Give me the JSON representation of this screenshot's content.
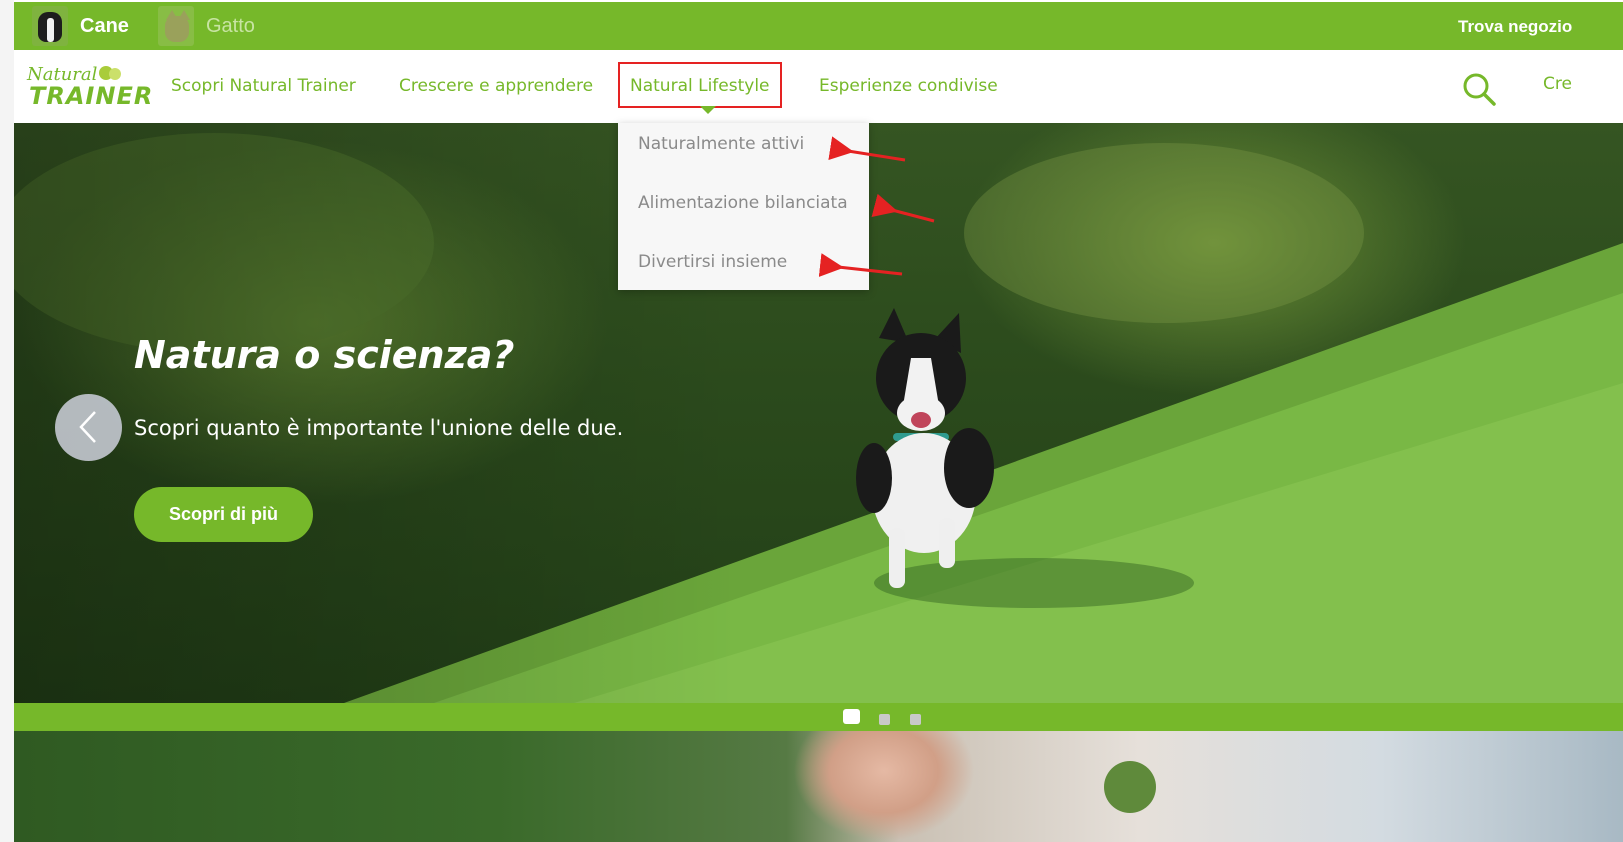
{
  "topbar": {
    "pets": [
      {
        "label": "Cane",
        "state": "active"
      },
      {
        "label": "Gatto",
        "state": "inactive"
      }
    ],
    "store_link": "Trova negozio"
  },
  "nav": {
    "logo": {
      "line1": "Natural",
      "line2": "TRAINER"
    },
    "items": [
      {
        "label": "Scopri Natural Trainer"
      },
      {
        "label": "Crescere e apprendere"
      },
      {
        "label": "Natural Lifestyle"
      },
      {
        "label": "Esperienze condivise"
      }
    ],
    "cut_link": "Cre",
    "icon": "search-icon"
  },
  "dropdown": {
    "items": [
      {
        "label": "Naturalmente attivi"
      },
      {
        "label": "Alimentazione bilanciata"
      },
      {
        "label": "Divertirsi insieme"
      }
    ]
  },
  "hero": {
    "title": "Natura o scienza?",
    "subtitle": "Scopri quanto è importante l'unione delle due.",
    "cta": "Scopri di più",
    "slides": 3,
    "current_slide": 1
  },
  "colors": {
    "brand_green": "#76b82a",
    "highlight_red": "#e52222",
    "dropdown_text": "#8a8a8a"
  }
}
